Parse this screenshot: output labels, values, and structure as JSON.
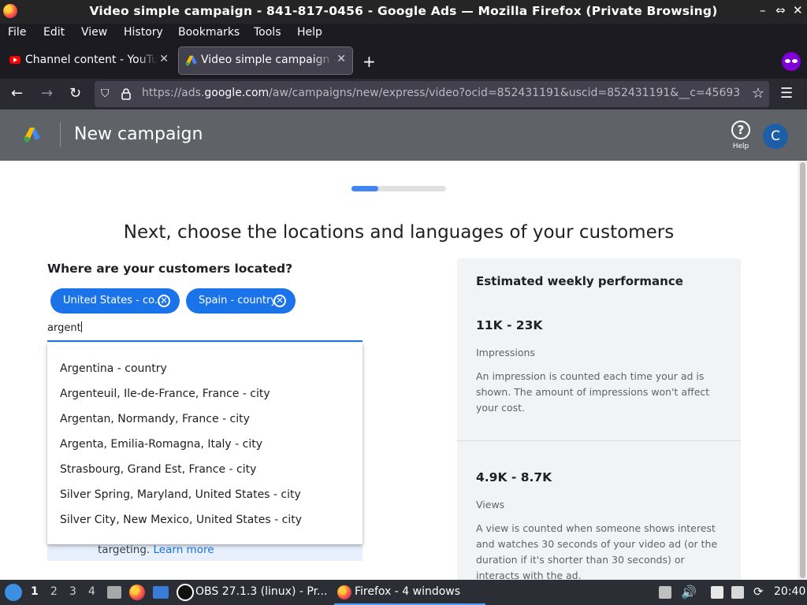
{
  "window": {
    "title": "Video simple campaign - 841-817-0456 - Google Ads — Mozilla Firefox (Private Browsing)",
    "controls": [
      "–",
      "⇔",
      "✕"
    ]
  },
  "menubar": {
    "items": [
      "File",
      "Edit",
      "View",
      "History",
      "Bookmarks",
      "Tools",
      "Help"
    ]
  },
  "tabs": [
    {
      "label": "Channel content - YouTube",
      "close": "✕"
    },
    {
      "label": "Video simple campaign - 841-817-0456",
      "close": "✕"
    }
  ],
  "newtab": "+",
  "nav": {
    "back": "←",
    "forward": "→",
    "reload": "↻",
    "url_prefix": "https://ads.",
    "url_domain": "google.com",
    "url_rest": "/aw/campaigns/new/express/video?ocid=852431191&uscid=852431191&__c=45693",
    "star": "☆",
    "menu": "☰"
  },
  "ads_header": {
    "title": "New campaign",
    "help_label": "Help",
    "help_icon": "?",
    "avatar_letter": "C"
  },
  "page": {
    "progress_fraction": 0.28,
    "heading": "Next, choose the locations and languages of your customers",
    "question": "Where are your customers located?",
    "chips": [
      {
        "label": "United States - co..."
      },
      {
        "label": "Spain - country"
      }
    ],
    "search_value": "argent",
    "suggestions": [
      "Argentina - country",
      "Argenteuil, Ile-de-France, France - city",
      "Argentan, Normandy, France - city",
      "Argenta, Emilia-Romagna, Italy - city",
      "Strasbourg, Grand Est, France - city",
      "Silver Spring, Maryland, United States - city",
      "Silver City, New Mexico, United States - city"
    ],
    "info_text": "targeting.",
    "info_link": "Learn more"
  },
  "performance": {
    "title": "Estimated weekly performance",
    "metrics": [
      {
        "value": "11K - 23K",
        "label": "Impressions",
        "description": "An impression is counted each time your ad is shown. The amount of impressions won't affect your cost."
      },
      {
        "value": "4.9K - 8.7K",
        "label": "Views",
        "description": "A view is counted when someone shows interest and watches 30 seconds of your video ad (or the duration if it's shorter than 30 seconds) or interacts with the ad."
      }
    ]
  },
  "taskbar": {
    "workspaces": [
      "1",
      "2",
      "3",
      "4"
    ],
    "task_obs": "OBS 27.1.3 (linux) - Pr...",
    "task_firefox": "Firefox - 4 windows",
    "clock": "20:40"
  }
}
